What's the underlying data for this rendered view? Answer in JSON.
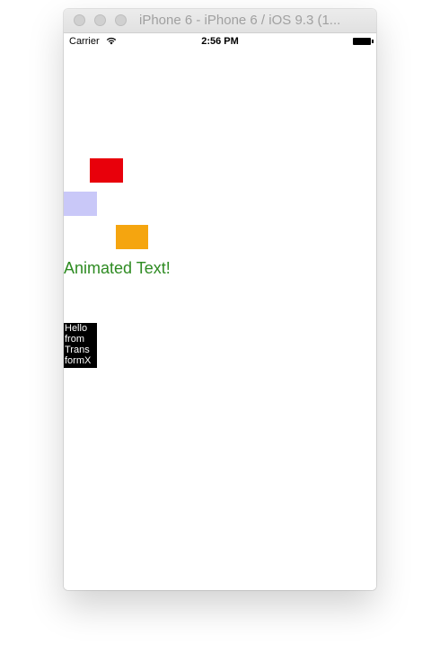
{
  "window": {
    "title": "iPhone 6 - iPhone 6 / iOS 9.3 (1..."
  },
  "statusbar": {
    "carrier": "Carrier",
    "time": "2:56 PM",
    "wifi_icon": "wifi-icon",
    "battery_icon": "battery-icon"
  },
  "content": {
    "boxes": [
      {
        "name": "red",
        "color": "#e8000b"
      },
      {
        "name": "lavender",
        "color": "#c9c8f8"
      },
      {
        "name": "orange",
        "color": "#f5a50f"
      }
    ],
    "animated_text": "Animated Text!",
    "animated_text_color": "#2e8b22",
    "transform_label_lines": [
      "Hello",
      "from",
      "Trans",
      "formX"
    ]
  }
}
